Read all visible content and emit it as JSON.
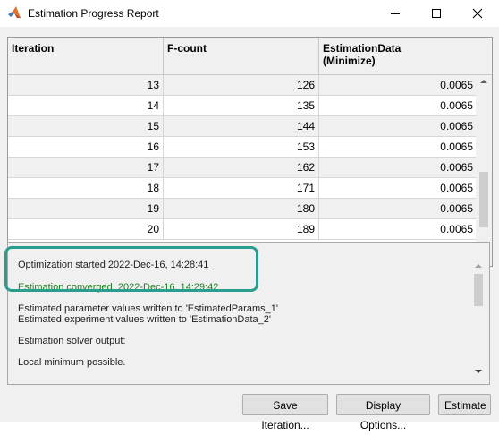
{
  "window": {
    "title": "Estimation Progress Report",
    "icon": "matlab-logo",
    "controls": [
      "minimize-icon",
      "maximize-icon",
      "close-icon"
    ]
  },
  "table": {
    "headers": [
      "Iteration",
      "F-count",
      "EstimationData\n(Minimize)"
    ],
    "header1": "Iteration",
    "header2": "F-count",
    "header3_line1": "EstimationData",
    "header3_line2": "(Minimize)",
    "rows": [
      {
        "iteration": "13",
        "fcount": "126",
        "value": "0.0065"
      },
      {
        "iteration": "14",
        "fcount": "135",
        "value": "0.0065"
      },
      {
        "iteration": "15",
        "fcount": "144",
        "value": "0.0065"
      },
      {
        "iteration": "16",
        "fcount": "153",
        "value": "0.0065"
      },
      {
        "iteration": "17",
        "fcount": "162",
        "value": "0.0065"
      },
      {
        "iteration": "18",
        "fcount": "171",
        "value": "0.0065"
      },
      {
        "iteration": "19",
        "fcount": "180",
        "value": "0.0065"
      },
      {
        "iteration": "20",
        "fcount": "189",
        "value": "0.0065"
      }
    ]
  },
  "log": {
    "lines": [
      "Optimization started 2022-Dec-16, 14:28:41",
      "Estimation converged, 2022-Dec-16, 14:29:42",
      "Estimated parameter values written to 'EstimatedParams_1'",
      "Estimated experiment values written to 'EstimationData_2'",
      "Estimation solver output:",
      "Local minimum possible."
    ]
  },
  "colors": {
    "converged_text": "#1f7d1f",
    "highlight_border": "#2a9e8e"
  },
  "buttons": {
    "save_iteration": "Save Iteration...",
    "display_options": "Display Options...",
    "estimate": "Estimate"
  }
}
